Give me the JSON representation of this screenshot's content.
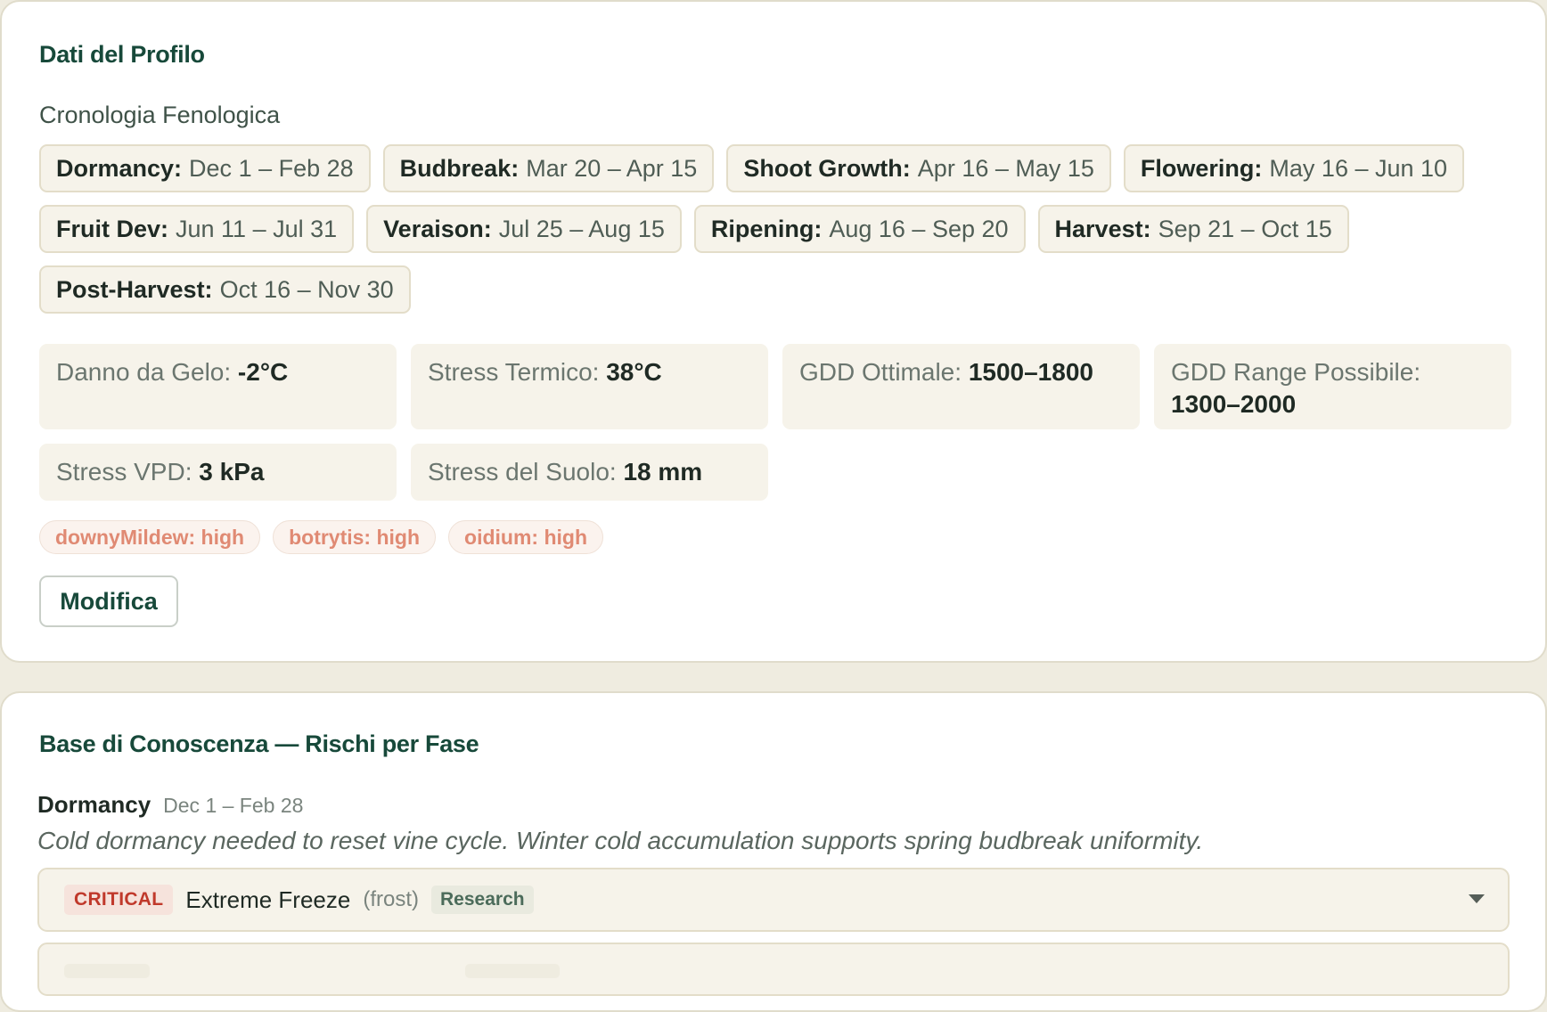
{
  "profile": {
    "title": "Dati del Profilo",
    "phenology_title": "Cronologia Fenologica",
    "phases": [
      {
        "name": "Dormancy:",
        "range": "Dec 1 – Feb 28"
      },
      {
        "name": "Budbreak:",
        "range": "Mar 20 – Apr 15"
      },
      {
        "name": "Shoot Growth:",
        "range": "Apr 16 – May 15"
      },
      {
        "name": "Flowering:",
        "range": "May 16 – Jun 10"
      },
      {
        "name": "Fruit Dev:",
        "range": "Jun 11 – Jul 31"
      },
      {
        "name": "Veraison:",
        "range": "Jul 25 – Aug 15"
      },
      {
        "name": "Ripening:",
        "range": "Aug 16 – Sep 20"
      },
      {
        "name": "Harvest:",
        "range": "Sep 21 – Oct 15"
      },
      {
        "name": "Post-Harvest:",
        "range": "Oct 16 – Nov 30"
      }
    ],
    "metrics": [
      {
        "label": "Danno da Gelo:",
        "value": "-2°C"
      },
      {
        "label": "Stress Termico:",
        "value": "38°C"
      },
      {
        "label": "GDD Ottimale:",
        "value": "1500–1800"
      },
      {
        "label": "GDD Range Possibile:",
        "value": "1300–2000"
      },
      {
        "label": "Stress VPD:",
        "value": "3 kPa"
      },
      {
        "label": "Stress del Suolo:",
        "value": "18 mm"
      }
    ],
    "disease_risks": [
      {
        "label": "downyMildew: high"
      },
      {
        "label": "botrytis: high"
      },
      {
        "label": "oidium: high"
      }
    ],
    "edit_label": "Modifica"
  },
  "knowledge": {
    "title": "Base di Conoscenza — Rischi per Fase",
    "phase": {
      "name": "Dormancy",
      "range": "Dec 1 – Feb 28"
    },
    "description": "Cold dormancy needed to reset vine cycle. Winter cold accumulation supports spring budbreak uniformity.",
    "risk": {
      "severity": "CRITICAL",
      "title": "Extreme Freeze",
      "type": "(frost)",
      "source": "Research"
    }
  },
  "colors": {
    "accent": "#17493a",
    "critical": "#c0392b",
    "risk_text": "#e08a73"
  }
}
